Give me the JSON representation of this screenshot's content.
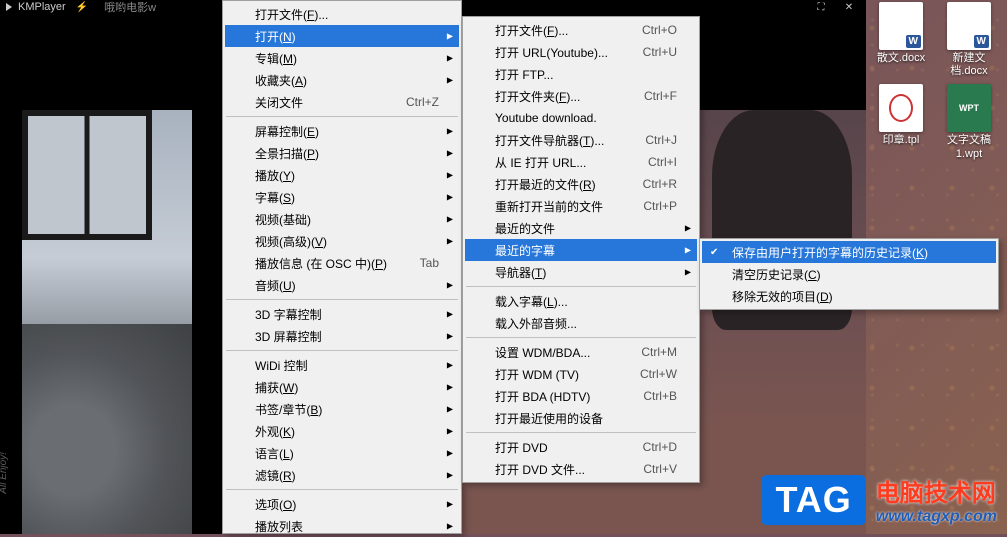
{
  "app": {
    "name": "KMPlayer",
    "tab_title": "哦哟电影w"
  },
  "vertical_text": "All Enjoy!",
  "win_controls": {
    "expand": "⛶",
    "close": "✕"
  },
  "desktop_icons": [
    [
      {
        "kind": "docx",
        "label": "散文.docx"
      },
      {
        "kind": "docx",
        "label": "新建文档.docx"
      }
    ],
    [
      {
        "kind": "tpl",
        "label": "印章.tpl"
      },
      {
        "kind": "wpt",
        "label": "文字文稿1.wpt"
      }
    ]
  ],
  "menu1": [
    {
      "t": "item",
      "label": "打开文件(F)..."
    },
    {
      "t": "item",
      "label": "打开(N)",
      "selected": true,
      "sub": true
    },
    {
      "t": "item",
      "label": "专辑(M)",
      "sub": true
    },
    {
      "t": "item",
      "label": "收藏夹(A)",
      "sub": true
    },
    {
      "t": "item",
      "label": "关闭文件",
      "shortcut": "Ctrl+Z"
    },
    {
      "t": "sep"
    },
    {
      "t": "item",
      "label": "屏幕控制(E)",
      "sub": true
    },
    {
      "t": "item",
      "label": "全景扫描(P)",
      "sub": true
    },
    {
      "t": "item",
      "label": "播放(Y)",
      "sub": true
    },
    {
      "t": "item",
      "label": "字幕(S)",
      "sub": true
    },
    {
      "t": "item",
      "label": "视频(基础)",
      "sub": true
    },
    {
      "t": "item",
      "label": "视频(高级)(V)",
      "sub": true
    },
    {
      "t": "item",
      "label": "播放信息 (在 OSC 中)(P)",
      "shortcut": "Tab"
    },
    {
      "t": "item",
      "label": "音频(U)",
      "sub": true
    },
    {
      "t": "sep"
    },
    {
      "t": "item",
      "label": "3D 字幕控制",
      "sub": true
    },
    {
      "t": "item",
      "label": "3D 屏幕控制",
      "sub": true
    },
    {
      "t": "sep"
    },
    {
      "t": "item",
      "label": "WiDi 控制",
      "sub": true
    },
    {
      "t": "item",
      "label": "捕获(W)",
      "sub": true
    },
    {
      "t": "item",
      "label": "书签/章节(B)",
      "sub": true
    },
    {
      "t": "item",
      "label": "外观(K)",
      "sub": true
    },
    {
      "t": "item",
      "label": "语言(L)",
      "sub": true
    },
    {
      "t": "item",
      "label": "滤镜(R)",
      "sub": true
    },
    {
      "t": "sep"
    },
    {
      "t": "item",
      "label": "选项(O)",
      "sub": true
    },
    {
      "t": "item",
      "label": "播放列表",
      "sub": true
    }
  ],
  "menu2": [
    {
      "t": "item",
      "label": "打开文件(F)...",
      "shortcut": "Ctrl+O"
    },
    {
      "t": "item",
      "label": "打开 URL(Youtube)...",
      "shortcut": "Ctrl+U"
    },
    {
      "t": "item",
      "label": "打开 FTP..."
    },
    {
      "t": "item",
      "label": "打开文件夹(F)...",
      "shortcut": "Ctrl+F"
    },
    {
      "t": "item",
      "label": "Youtube download."
    },
    {
      "t": "item",
      "label": "打开文件导航器(T)...",
      "shortcut": "Ctrl+J"
    },
    {
      "t": "item",
      "label": "从 IE 打开 URL...",
      "shortcut": "Ctrl+I"
    },
    {
      "t": "item",
      "label": "打开最近的文件(R)",
      "shortcut": "Ctrl+R"
    },
    {
      "t": "item",
      "label": "重新打开当前的文件",
      "shortcut": "Ctrl+P"
    },
    {
      "t": "item",
      "label": "最近的文件",
      "sub": true
    },
    {
      "t": "item",
      "label": "最近的字幕",
      "selected": true,
      "sub": true
    },
    {
      "t": "item",
      "label": "导航器(T)",
      "sub": true
    },
    {
      "t": "sep"
    },
    {
      "t": "item",
      "label": "载入字幕(L)..."
    },
    {
      "t": "item",
      "label": "载入外部音频..."
    },
    {
      "t": "sep"
    },
    {
      "t": "item",
      "label": "设置 WDM/BDA...",
      "shortcut": "Ctrl+M"
    },
    {
      "t": "item",
      "label": "打开 WDM (TV)",
      "shortcut": "Ctrl+W"
    },
    {
      "t": "item",
      "label": "打开 BDA (HDTV)",
      "shortcut": "Ctrl+B"
    },
    {
      "t": "item",
      "label": "打开最近使用的设备"
    },
    {
      "t": "sep"
    },
    {
      "t": "item",
      "label": "打开 DVD",
      "shortcut": "Ctrl+D"
    },
    {
      "t": "item",
      "label": "打开 DVD 文件...",
      "shortcut": "Ctrl+V"
    }
  ],
  "menu3": [
    {
      "t": "item",
      "label": "保存由用户打开的字幕的历史记录(K)",
      "selected": true,
      "checked": true
    },
    {
      "t": "item",
      "label": "清空历史记录(C)"
    },
    {
      "t": "item",
      "label": "移除无效的项目(D)"
    }
  ],
  "watermark": {
    "badge": "TAG",
    "line1": "电脑技术网",
    "line2": "www.tagxp.com"
  }
}
